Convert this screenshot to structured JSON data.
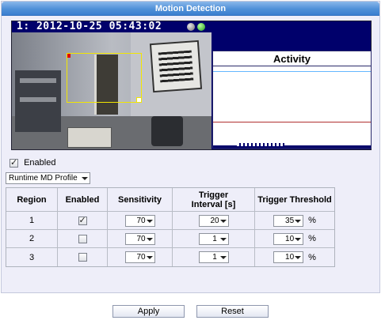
{
  "window": {
    "title": "Motion Detection"
  },
  "camera": {
    "osd": "1:  2012-10-25 05:43:02",
    "status_icons": [
      "grey-circle-icon",
      "green-circle-icon"
    ]
  },
  "activity": {
    "title": "Activity"
  },
  "enable": {
    "label": "Enabled",
    "checked": true
  },
  "profile": {
    "selected": "Runtime MD Profile"
  },
  "table": {
    "headers": [
      "Region",
      "Enabled",
      "Sensitivity",
      "Trigger Interval [s]",
      "Trigger Threshold"
    ],
    "rows": [
      {
        "region": "1",
        "enabled": true,
        "sensitivity": "70",
        "interval": "20",
        "threshold": "35",
        "unit": "%"
      },
      {
        "region": "2",
        "enabled": false,
        "sensitivity": "70",
        "interval": "1",
        "threshold": "10",
        "unit": "%"
      },
      {
        "region": "3",
        "enabled": false,
        "sensitivity": "70",
        "interval": "1",
        "threshold": "10",
        "unit": "%"
      }
    ]
  },
  "buttons": {
    "apply": "Apply",
    "reset": "Reset"
  },
  "colors": {
    "title_bar": "#4f90d8",
    "panel_bg": "#eeeef9",
    "osd_bg": "#00006b",
    "region_outline": "#f2e600"
  }
}
